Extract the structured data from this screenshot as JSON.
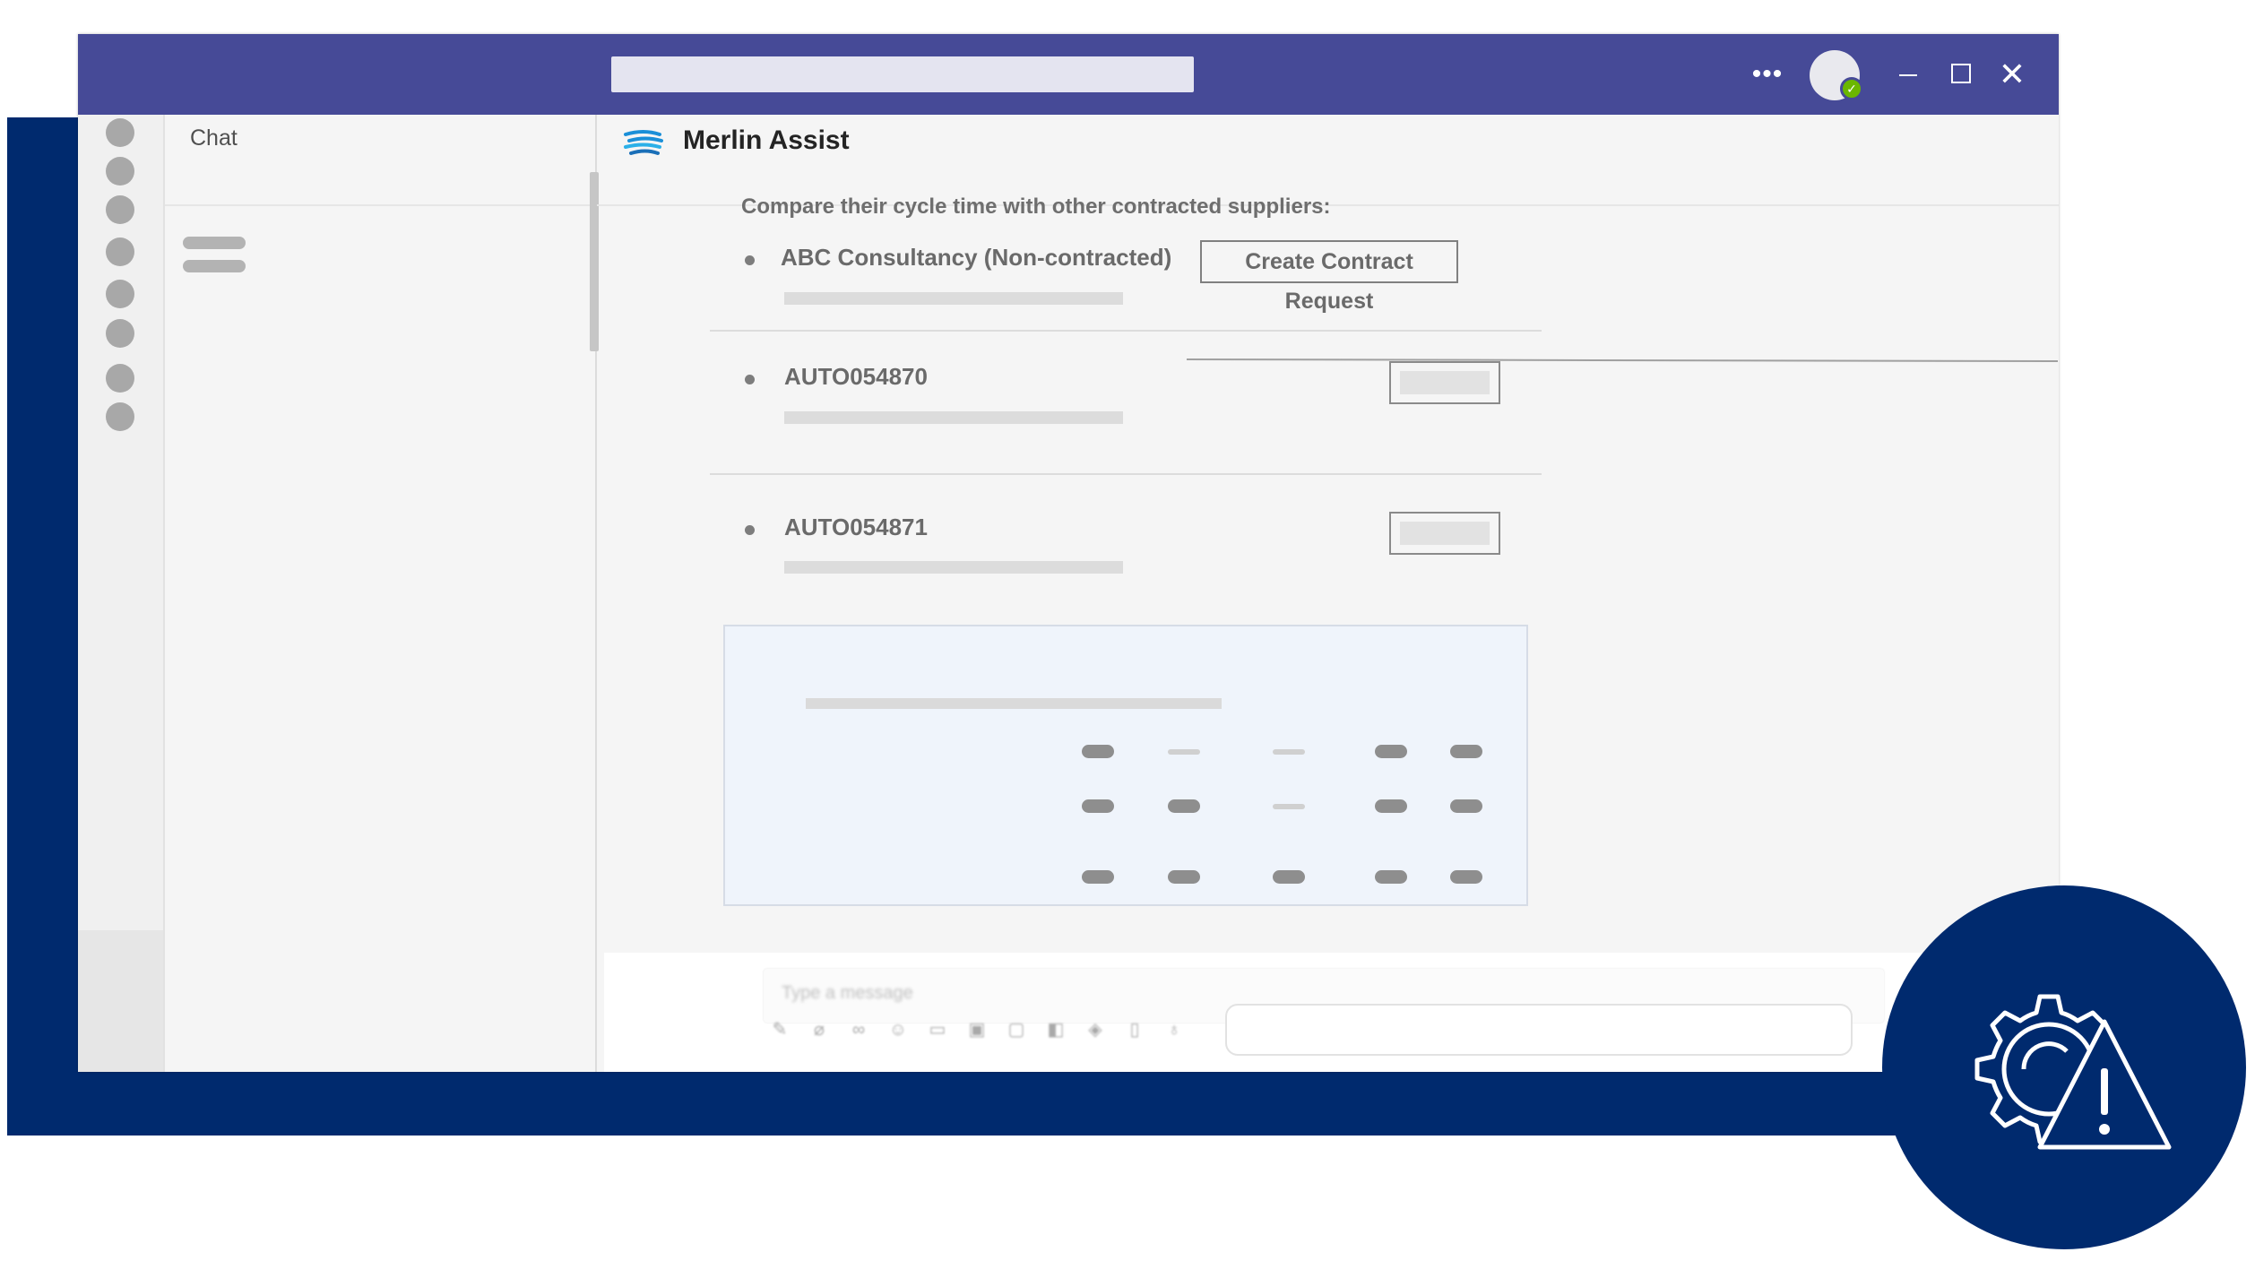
{
  "window": {
    "title_search_text": "",
    "controls": {
      "more_icon": "ellipsis-icon",
      "minimize_icon": "minimize-icon",
      "maximize_icon": "maximize-icon",
      "close_glyph": "✕"
    },
    "presence_glyph": "✓"
  },
  "sidebar": {
    "chat_label": "Chat"
  },
  "main": {
    "app_name": "Merlin Assist",
    "compare_prompt": "Compare their cycle time with other contracted suppliers:",
    "suppliers": [
      {
        "label": "ABC Consultancy (Non-contracted)",
        "action_label": "Create Contract Request"
      },
      {
        "label": "AUTO054870",
        "action_label": ""
      },
      {
        "label": "AUTO054871",
        "action_label": ""
      }
    ]
  },
  "compose": {
    "placeholder": "Type a message",
    "toolbar_icons": [
      "format-icon",
      "attach-icon",
      "link-icon",
      "emoji-icon",
      "gif-icon",
      "sticker-icon",
      "meet-icon",
      "schedule-icon",
      "loop-icon",
      "praise-icon",
      "more-options-icon"
    ]
  },
  "colors": {
    "titlebar": "#464a97",
    "navy": "#002a6e",
    "presence": "#6bb700",
    "card": "#eff4fb"
  }
}
